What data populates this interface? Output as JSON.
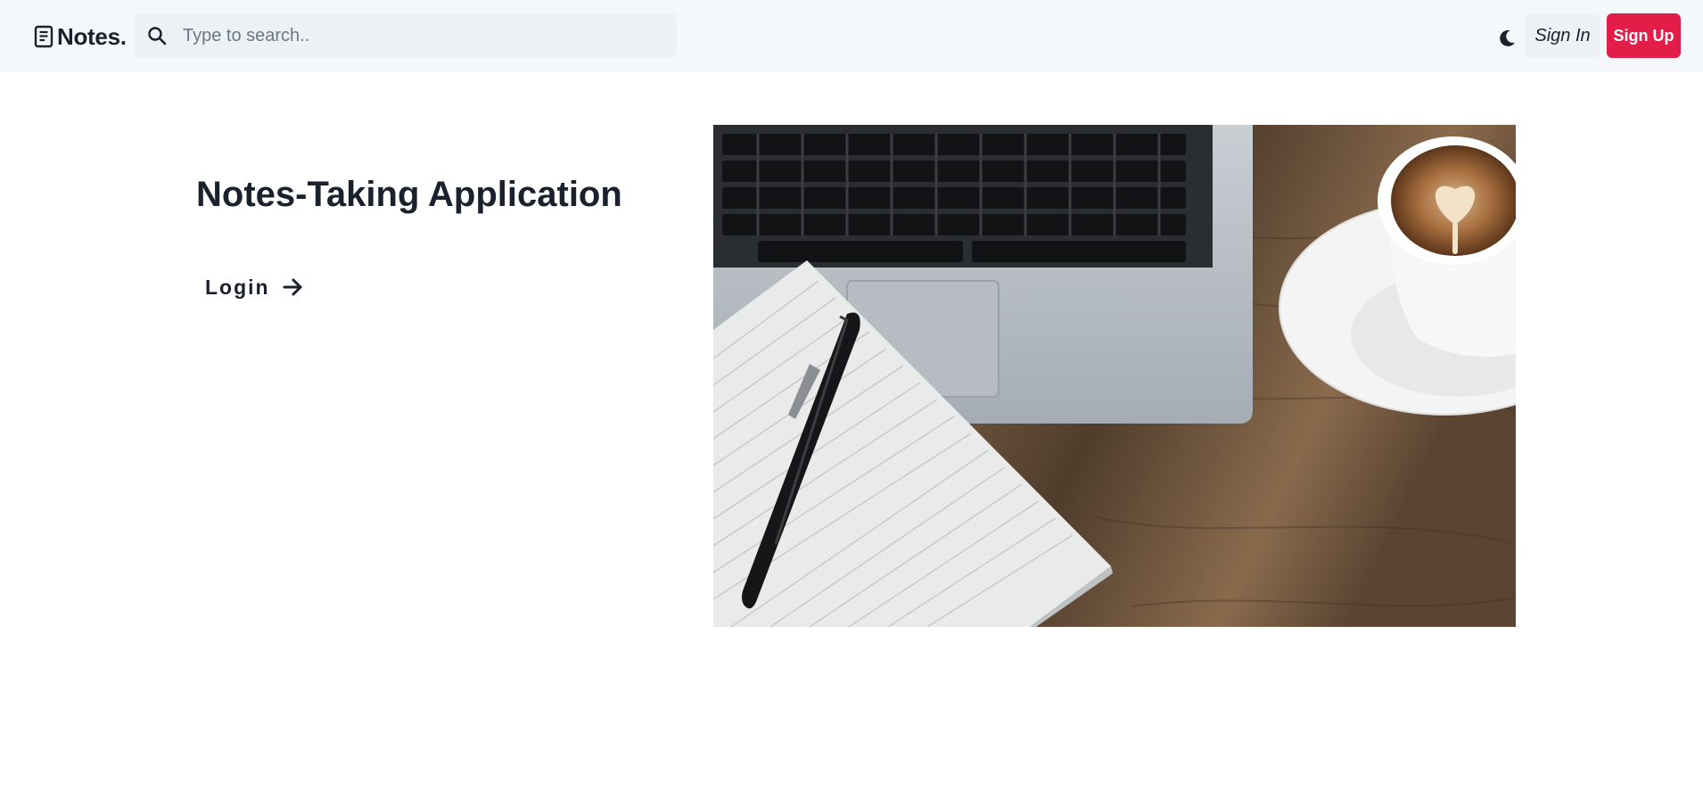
{
  "header": {
    "brand": "Notes.",
    "search_placeholder": "Type to search..",
    "sign_in_label": "Sign In",
    "sign_up_label": "Sign Up",
    "icons": {
      "logo": "document-icon",
      "search": "search-icon",
      "theme": "moon-icon"
    }
  },
  "hero": {
    "title": "Notes-Taking Application",
    "login_label": "Login",
    "login_icon": "arrow-right-icon",
    "image": "laptop-notebook-pen-coffee-photo"
  },
  "colors": {
    "accent": "#e11d48",
    "navbar_bg": "#f5f8fa",
    "input_bg": "#edf1f5",
    "text": "#1a202c"
  }
}
